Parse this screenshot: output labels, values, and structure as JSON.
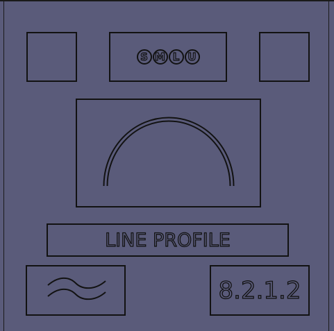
{
  "size_selector": {
    "options": [
      "S",
      "M",
      "L",
      "U"
    ]
  },
  "profile_panel": {
    "title": "LINE PROFILE",
    "profile_icon": "arc-profile-icon"
  },
  "tolerance_panel": {
    "icon": "wave-icon",
    "section_code": "8.2.1.2"
  },
  "colors": {
    "background": "#5a5b7a",
    "outline": "#121212"
  }
}
